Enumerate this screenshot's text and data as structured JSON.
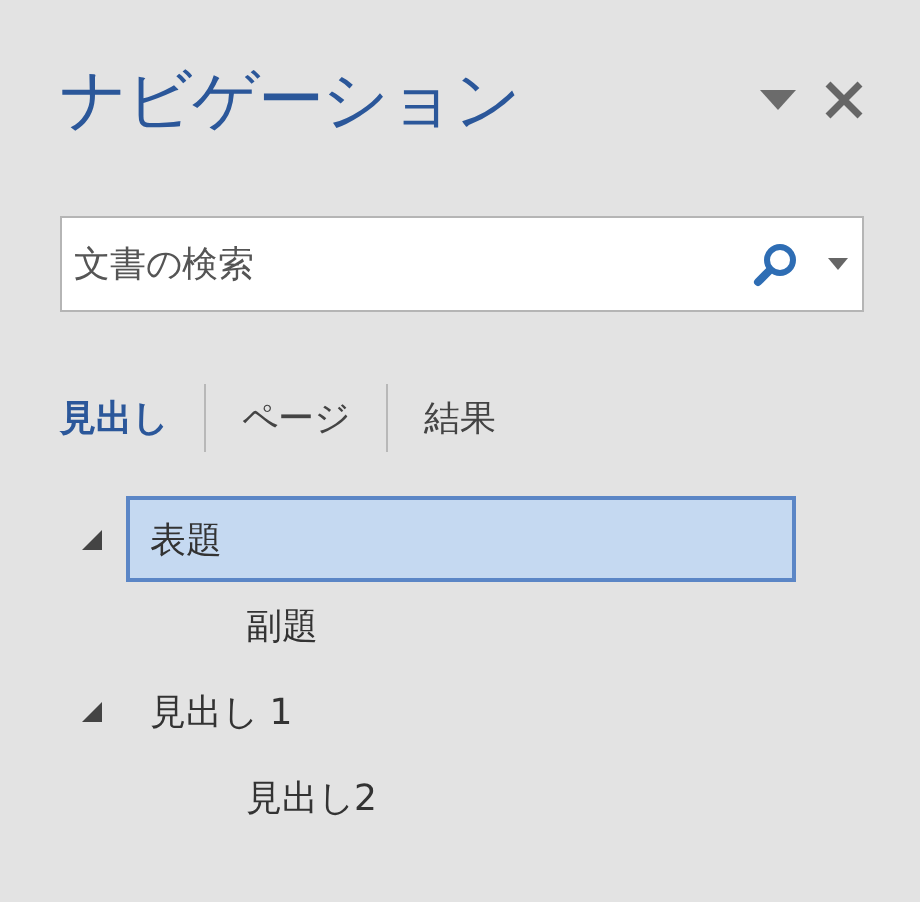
{
  "pane": {
    "title": "ナビゲーション"
  },
  "search": {
    "placeholder": "文書の検索"
  },
  "tabs": [
    {
      "label": "見出し",
      "selected": true
    },
    {
      "label": "ページ",
      "selected": false
    },
    {
      "label": "結果",
      "selected": false
    }
  ],
  "outline": [
    {
      "label": "表題",
      "selected": true,
      "expanded": true,
      "children": [
        {
          "label": "副題",
          "selected": false
        }
      ]
    },
    {
      "label": "見出し 1",
      "selected": false,
      "expanded": true,
      "children": [
        {
          "label": "見出し2",
          "selected": false
        }
      ]
    }
  ]
}
